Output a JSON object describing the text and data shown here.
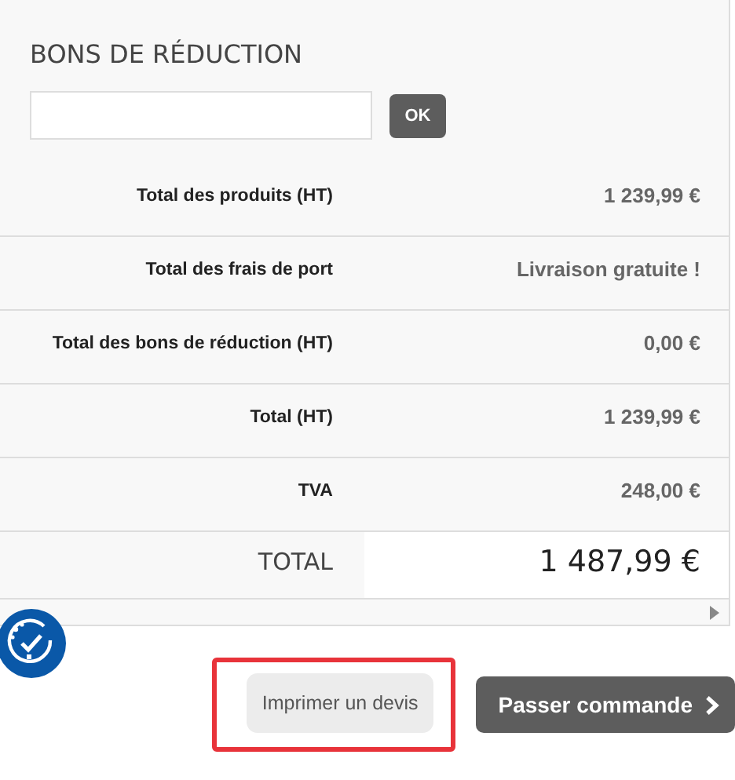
{
  "section_title": "BONS DE RÉDUCTION",
  "voucher": {
    "button": "OK"
  },
  "summary": [
    {
      "kind": "line",
      "label": "Total des produits (HT)",
      "value": "1 239,99 €"
    },
    {
      "kind": "line",
      "label": "Total des frais de port",
      "value": "Livraison gratuite !"
    },
    {
      "kind": "line",
      "label": "Total des bons de réduction (HT)",
      "value": "0,00 €"
    },
    {
      "kind": "line",
      "label": "Total (HT)",
      "value": "1 239,99 €"
    },
    {
      "kind": "line",
      "label": "TVA",
      "value": "248,00 €"
    },
    {
      "kind": "grand",
      "label": "TOTAL",
      "value": "1 487,99 €"
    }
  ],
  "actions": {
    "quote": {
      "label": "Imprimer un devis",
      "highlighted": true
    },
    "checkout": {
      "label": "Passer commande"
    }
  }
}
